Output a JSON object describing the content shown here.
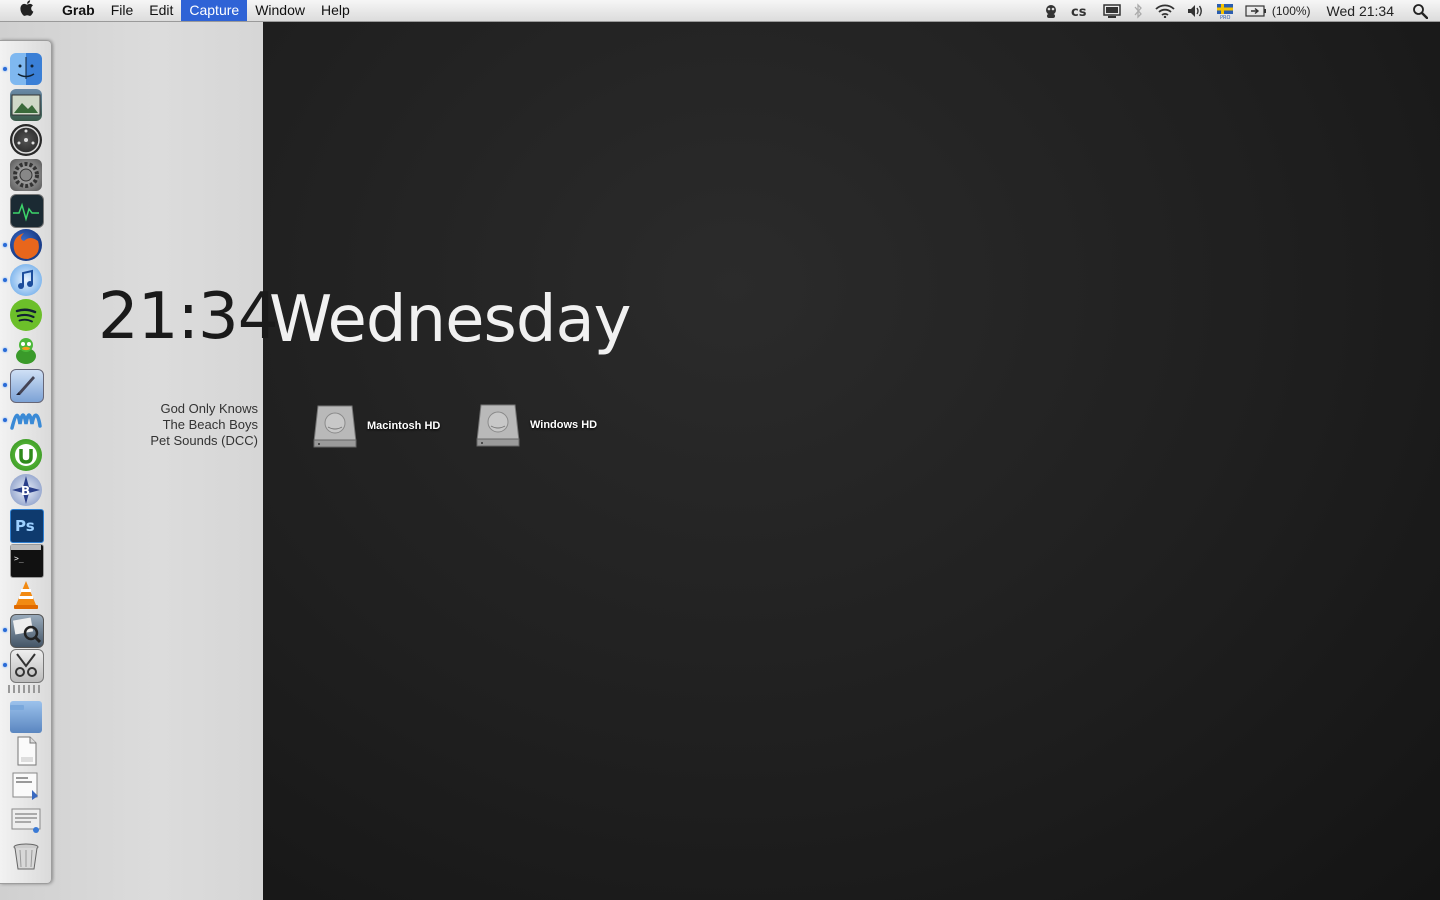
{
  "menubar": {
    "apple_symbol": "",
    "app_name": "Grab",
    "menus": [
      "File",
      "Edit",
      "Capture",
      "Window",
      "Help"
    ],
    "active_menu": "Capture",
    "status": {
      "battery_text": "(100%)",
      "clock_text": "Wed 21:34",
      "icons": [
        "adium-icon",
        "lastfm-icon",
        "display-icon",
        "bluetooth-icon",
        "wifi-icon",
        "volume-icon",
        "flag-sweden-icon",
        "battery-icon",
        "spotlight-icon"
      ]
    }
  },
  "dock": {
    "items": [
      {
        "name": "finder",
        "running": true
      },
      {
        "name": "iphoto",
        "running": false
      },
      {
        "name": "dashboard",
        "running": false
      },
      {
        "name": "system-preferences",
        "running": false
      },
      {
        "name": "activity-monitor",
        "running": false
      },
      {
        "name": "firefox",
        "running": true
      },
      {
        "name": "itunes",
        "running": true
      },
      {
        "name": "spotify",
        "running": false
      },
      {
        "name": "adium",
        "running": true
      },
      {
        "name": "mail",
        "running": true
      },
      {
        "name": "wunderbar",
        "running": true
      },
      {
        "name": "utorrent",
        "running": false
      },
      {
        "name": "bbedit",
        "running": false
      },
      {
        "name": "photoshop",
        "running": false
      },
      {
        "name": "terminal",
        "running": false
      },
      {
        "name": "vlc",
        "running": false
      },
      {
        "name": "preview",
        "running": true
      },
      {
        "name": "grab",
        "running": true
      }
    ],
    "stacks": [
      "applications-folder",
      "documents-stack",
      "downloads-stack",
      "text-stack",
      "trash"
    ]
  },
  "widget": {
    "time": "21:34",
    "day": "Wednesday"
  },
  "now_playing": {
    "track": "God Only Knows",
    "artist": "The Beach Boys",
    "album": "Pet Sounds (DCC)"
  },
  "desktop": {
    "drives": [
      {
        "label": "Macintosh HD"
      },
      {
        "label": "Windows HD"
      }
    ]
  }
}
